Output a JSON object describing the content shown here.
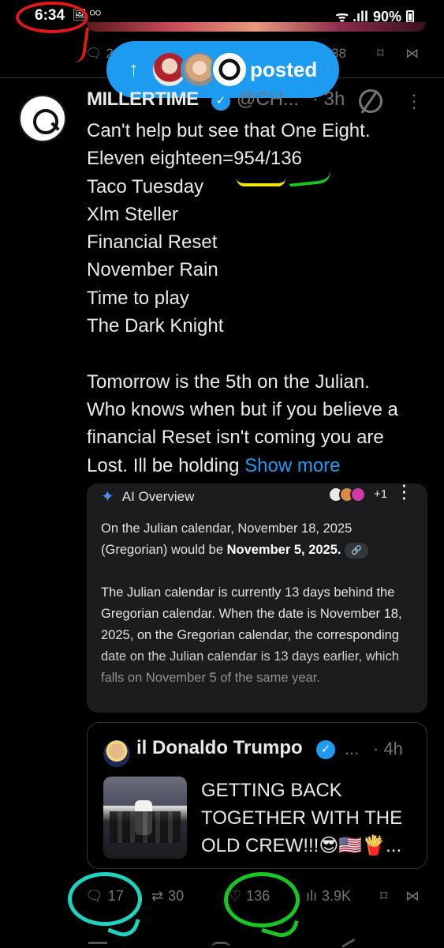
{
  "status_bar": {
    "time": "6:34",
    "left_icons": "🖼 ᴼᴼ",
    "signal": "ᯤ .ıll",
    "battery": "90%"
  },
  "prev_tweet_actions": {
    "reply_count": "2",
    "views_count": "38"
  },
  "posted_pill": {
    "arrow": "↑",
    "label": "posted"
  },
  "tweet": {
    "name": "MILLERTIME",
    "handle": "@CH...",
    "time": "· 3h",
    "lines": [
      "Can't help but see that One  Eight.",
      "Eleven eighteen=954/136",
      "Taco Tuesday",
      "Xlm Steller",
      "Financial Reset",
      "November Rain",
      "Time to play",
      "The Dark Knight",
      "",
      "Tomorrow is the 5th on the Julian.",
      "Who knows when but if you believe a",
      "financial Reset isn't coming you are",
      "Lost. Ill be holding "
    ],
    "show_more": "Show more"
  },
  "ai_overview": {
    "title": "AI Overview",
    "sources_more": "+1",
    "para1_a": "On the Julian calendar, November 18, 2025 (Gregorian) would be ",
    "para1_b": "November 5, 2025.",
    "para2": "The Julian calendar is currently 13 days behind the Gregorian calendar. When the date is November 18, 2025, on the Gregorian calendar, the corresponding date on the Julian calendar is 13 days earlier, which falls on November 5 of the same year."
  },
  "quote": {
    "name": "il Donaldo Trumpo",
    "dots": "...",
    "time": "· 4h",
    "text": "GETTING BACK TOGETHER WITH THE OLD CREW!!!😎🇺🇸🍟..."
  },
  "actions": {
    "reply_count": "17",
    "repost_count": "30",
    "like_count": "136",
    "views_count": "3.9K"
  },
  "colors": {
    "accent": "#1d9bf0",
    "annotation_red": "#e31919",
    "annotation_yellow": "#f5e800",
    "annotation_green": "#18c523",
    "annotation_cyan": "#1fd3c1"
  },
  "icons": [
    "reply-icon",
    "repost-icon",
    "like-icon",
    "views-icon",
    "bookmark-icon",
    "share-icon",
    "verified-icon",
    "grok-icon",
    "more-icon",
    "sparkle-icon"
  ]
}
